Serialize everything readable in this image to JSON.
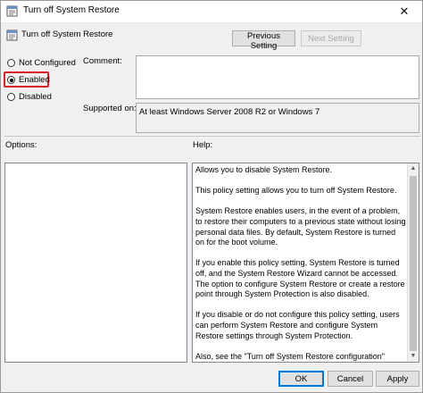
{
  "window": {
    "title": "Turn off System Restore",
    "close_glyph": "✕"
  },
  "header": {
    "policy_name": "Turn off System Restore",
    "prev_label": "Previous Setting",
    "next_label": "Next Setting"
  },
  "state": {
    "options": [
      {
        "label": "Not Configured",
        "checked": false
      },
      {
        "label": "Enabled",
        "checked": true
      },
      {
        "label": "Disabled",
        "checked": false
      }
    ]
  },
  "comment": {
    "label": "Comment:",
    "value": ""
  },
  "supported": {
    "label": "Supported on:",
    "value": "At least Windows Server 2008 R2 or Windows 7"
  },
  "sections": {
    "options_label": "Options:",
    "help_label": "Help:"
  },
  "help": {
    "paragraphs": [
      "Allows you to disable System Restore.",
      "This policy setting allows you to turn off System Restore.",
      "System Restore enables users, in the event of a problem, to restore their computers to a previous state without losing personal data files. By default, System Restore is turned on for the boot volume.",
      "If you enable this policy setting, System Restore is turned off, and the System Restore Wizard cannot be accessed. The option to configure System Restore or create a restore point through System Protection is also disabled.",
      "If you disable or do not configure this policy setting, users can perform System Restore and configure System Restore settings through System Protection.",
      "Also, see the \"Turn off System Restore configuration\" policy setting. If the \"Turn off System Restore\" policy setting is disabled or not configured, the \"Turn off System Restore configuration\""
    ]
  },
  "footer": {
    "ok_label": "OK",
    "cancel_label": "Cancel",
    "apply_label": "Apply"
  },
  "icons": {
    "title": "policy-icon",
    "policy": "policy-icon"
  },
  "colors": {
    "highlight": "#d8202a",
    "focus": "#0078d7"
  }
}
